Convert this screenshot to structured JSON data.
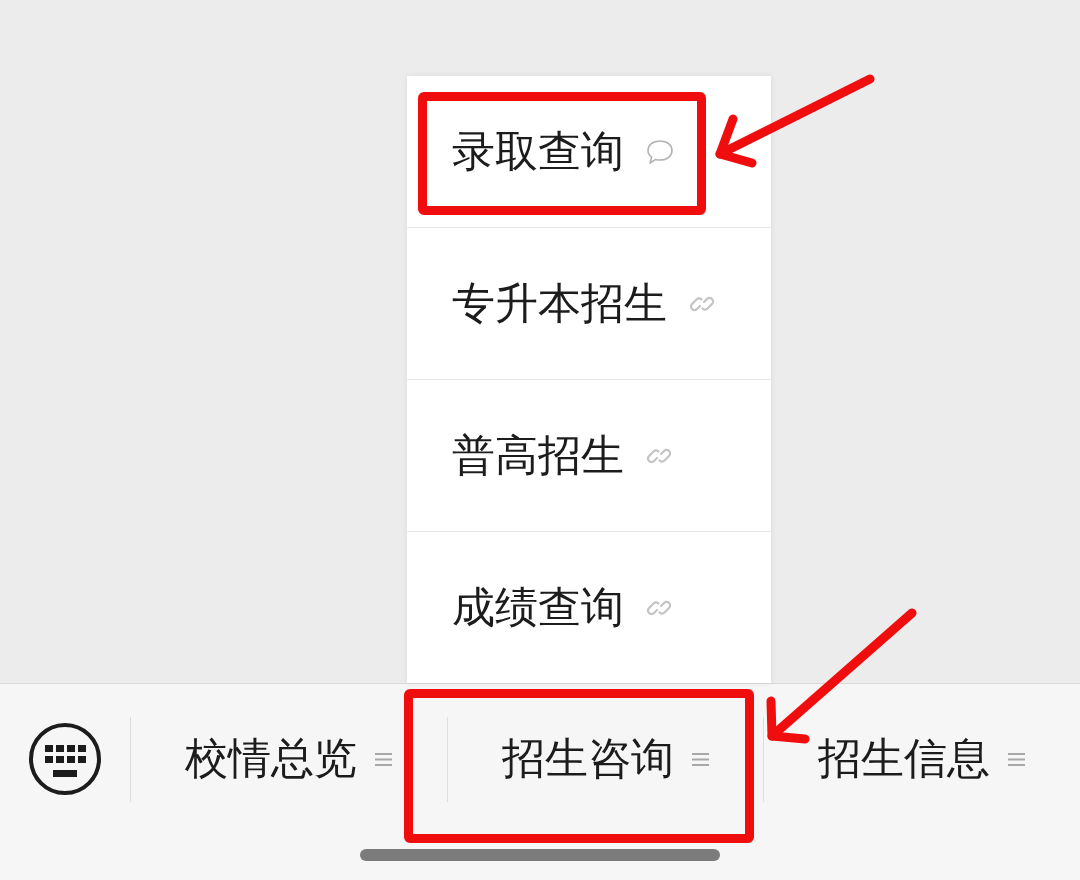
{
  "popup_menu": {
    "items": [
      {
        "label": "录取查询",
        "kind": "chat",
        "annotated": true
      },
      {
        "label": "专升本招生",
        "kind": "link",
        "annotated": false
      },
      {
        "label": "普高招生",
        "kind": "link",
        "annotated": false
      },
      {
        "label": "成绩查询",
        "kind": "link",
        "annotated": false
      }
    ]
  },
  "tab_bar": {
    "tabs": [
      {
        "label": "校情总览",
        "annotated": false
      },
      {
        "label": "招生咨询",
        "annotated": true
      },
      {
        "label": "招生信息",
        "annotated": false
      }
    ]
  }
}
